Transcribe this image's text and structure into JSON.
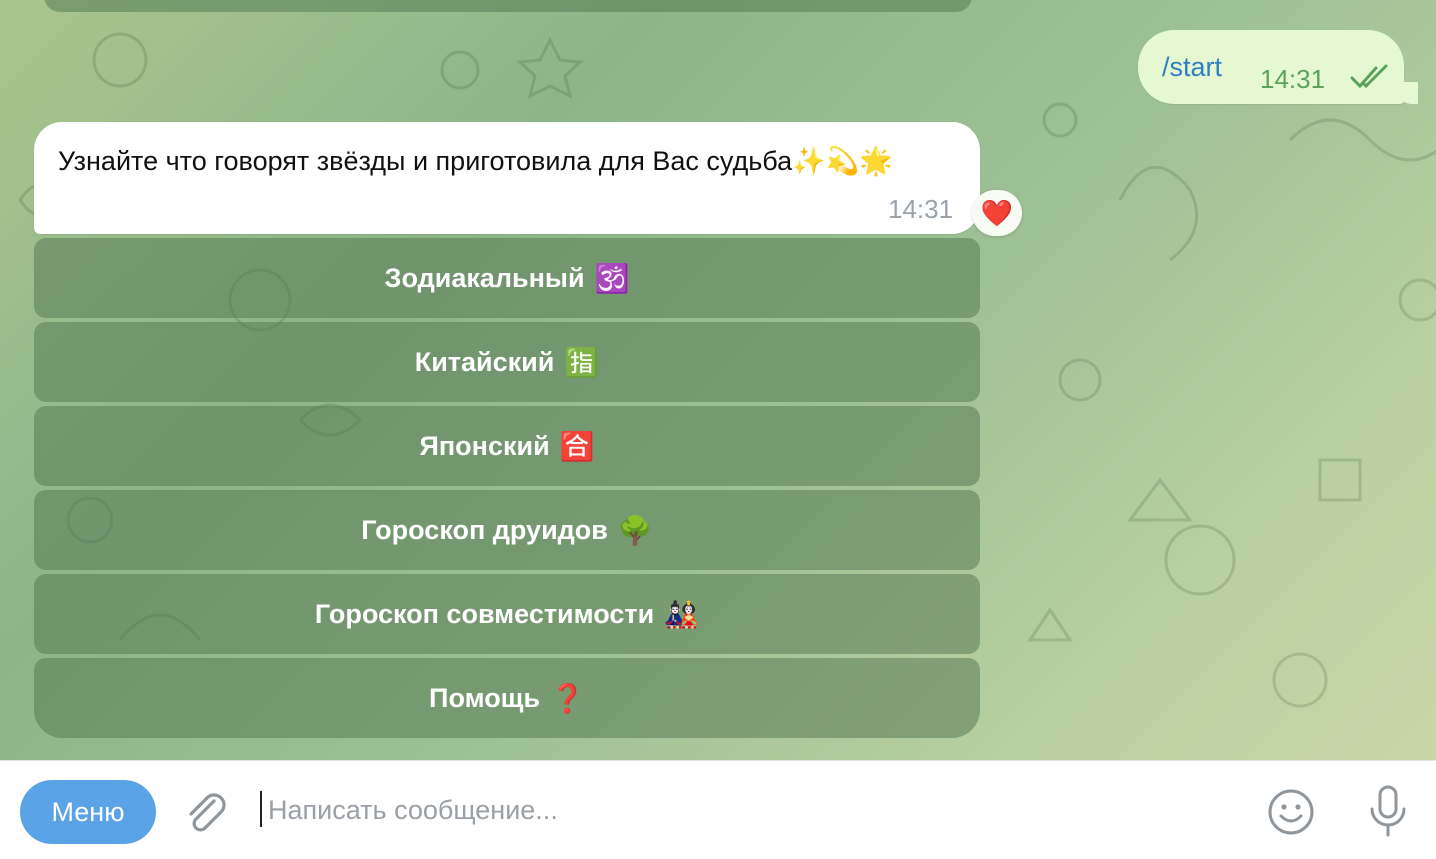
{
  "outgoing": {
    "text": "/start",
    "time": "14:31"
  },
  "incoming": {
    "text": "Узнайте что говорят звёзды и приготовила для Вас судьба✨💫🌟",
    "time": "14:31",
    "reaction": "❤️"
  },
  "keyboard": [
    {
      "label": "Зодиакальный",
      "emoji": "🕉️"
    },
    {
      "label": "Китайский",
      "emoji": "🈯"
    },
    {
      "label": "Японский",
      "emoji": "🈴"
    },
    {
      "label": "Гороскоп друидов",
      "emoji": "🌳"
    },
    {
      "label": "Гороскоп совместимости",
      "emoji": "🎎"
    },
    {
      "label": "Помощь",
      "emoji": "❓"
    }
  ],
  "input": {
    "menu_label": "Меню",
    "placeholder": "Написать сообщение..."
  },
  "colors": {
    "menu_button": "#5aa3e6",
    "outgoing_bubble": "#e5f8d2",
    "link_text": "#2f7fc4",
    "keyboard_button": "#547650"
  }
}
